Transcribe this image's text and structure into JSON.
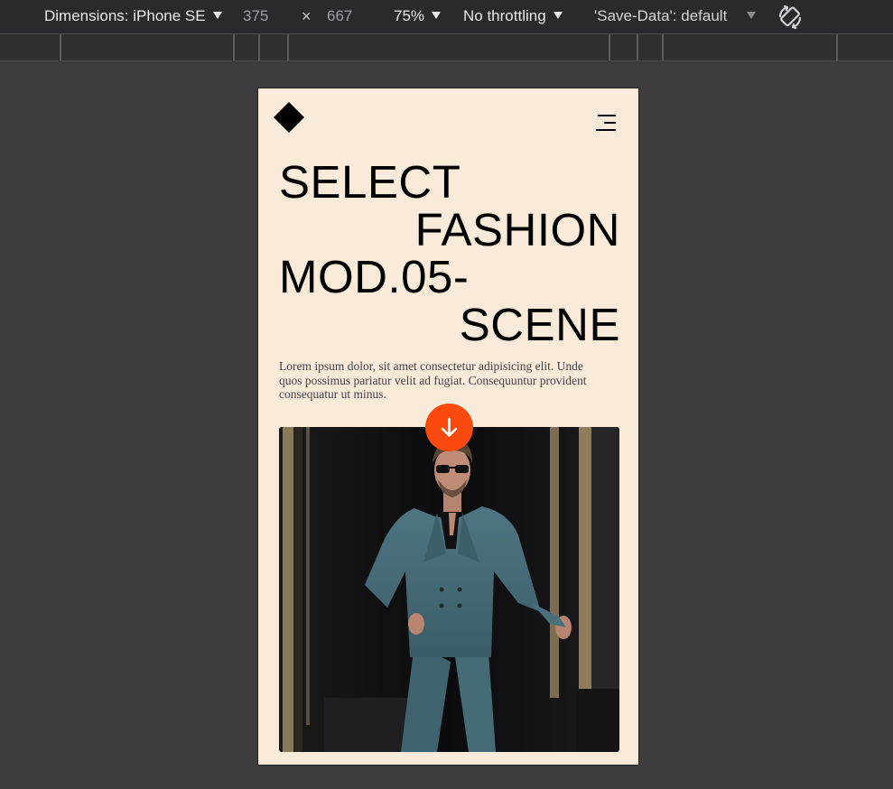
{
  "devtools": {
    "device_label": "Dimensions: iPhone SE",
    "width": "375",
    "times": "×",
    "height": "667",
    "zoom": "75%",
    "throttling": "No throttling",
    "save_data": "'Save-Data': default"
  },
  "page": {
    "headline": [
      "SELECT",
      "FASHION",
      "MOD.05-",
      "SCENE"
    ],
    "description": "Lorem ipsum dolor, sit amet consectetur adipisicing elit. Unde quos possimus pariatur velit ad fugiat. Consequuntur provident consequatur ut minus.",
    "accent_color": "#fa4a0e",
    "background_color": "#f9ead9",
    "icons": {
      "logo": "diamond-logo-icon",
      "menu": "hamburger-menu-icon",
      "scroll": "arrow-down-icon",
      "rotate": "rotate-device-icon"
    }
  }
}
